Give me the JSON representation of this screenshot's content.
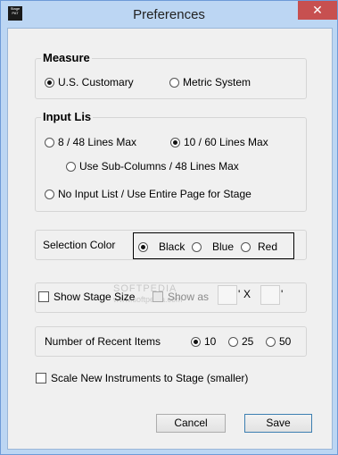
{
  "window": {
    "title": "Preferences",
    "close_glyph": "✕",
    "icon_text": "Stage PAT"
  },
  "measure": {
    "label": "Measure",
    "options": [
      {
        "label": "U.S. Customary",
        "selected": true
      },
      {
        "label": "Metric System",
        "selected": false
      }
    ]
  },
  "input_list": {
    "label": "Input Lis",
    "options": [
      {
        "label": "8 / 48 Lines Max",
        "selected": false
      },
      {
        "label": "10 / 60 Lines Max",
        "selected": true
      },
      {
        "label": "Use Sub-Columns / 48 Lines Max",
        "selected": false
      },
      {
        "label": "No Input List / Use Entire Page for Stage",
        "selected": false
      }
    ]
  },
  "selection_color": {
    "label": "Selection Color",
    "options": [
      {
        "label": "Black",
        "selected": true
      },
      {
        "label": "Blue",
        "selected": false
      },
      {
        "label": "Red",
        "selected": false
      }
    ]
  },
  "stage_size": {
    "show_label": "Show Stage Size",
    "show_checked": false,
    "show_as_label": "Show as",
    "show_as_checked": false,
    "sep_quote1": "'",
    "sep_x": "X",
    "sep_quote2": "'",
    "width_value": "",
    "height_value": ""
  },
  "recent_items": {
    "label": "Number of Recent Items",
    "options": [
      {
        "label": "10",
        "selected": true
      },
      {
        "label": "25",
        "selected": false
      },
      {
        "label": "50",
        "selected": false
      }
    ]
  },
  "scale": {
    "label": "Scale New Instruments to Stage (smaller)",
    "checked": false
  },
  "buttons": {
    "cancel": "Cancel",
    "save": "Save"
  },
  "watermark": "SOFTPEDIA",
  "watermark_sub": "www.softpedia.com"
}
